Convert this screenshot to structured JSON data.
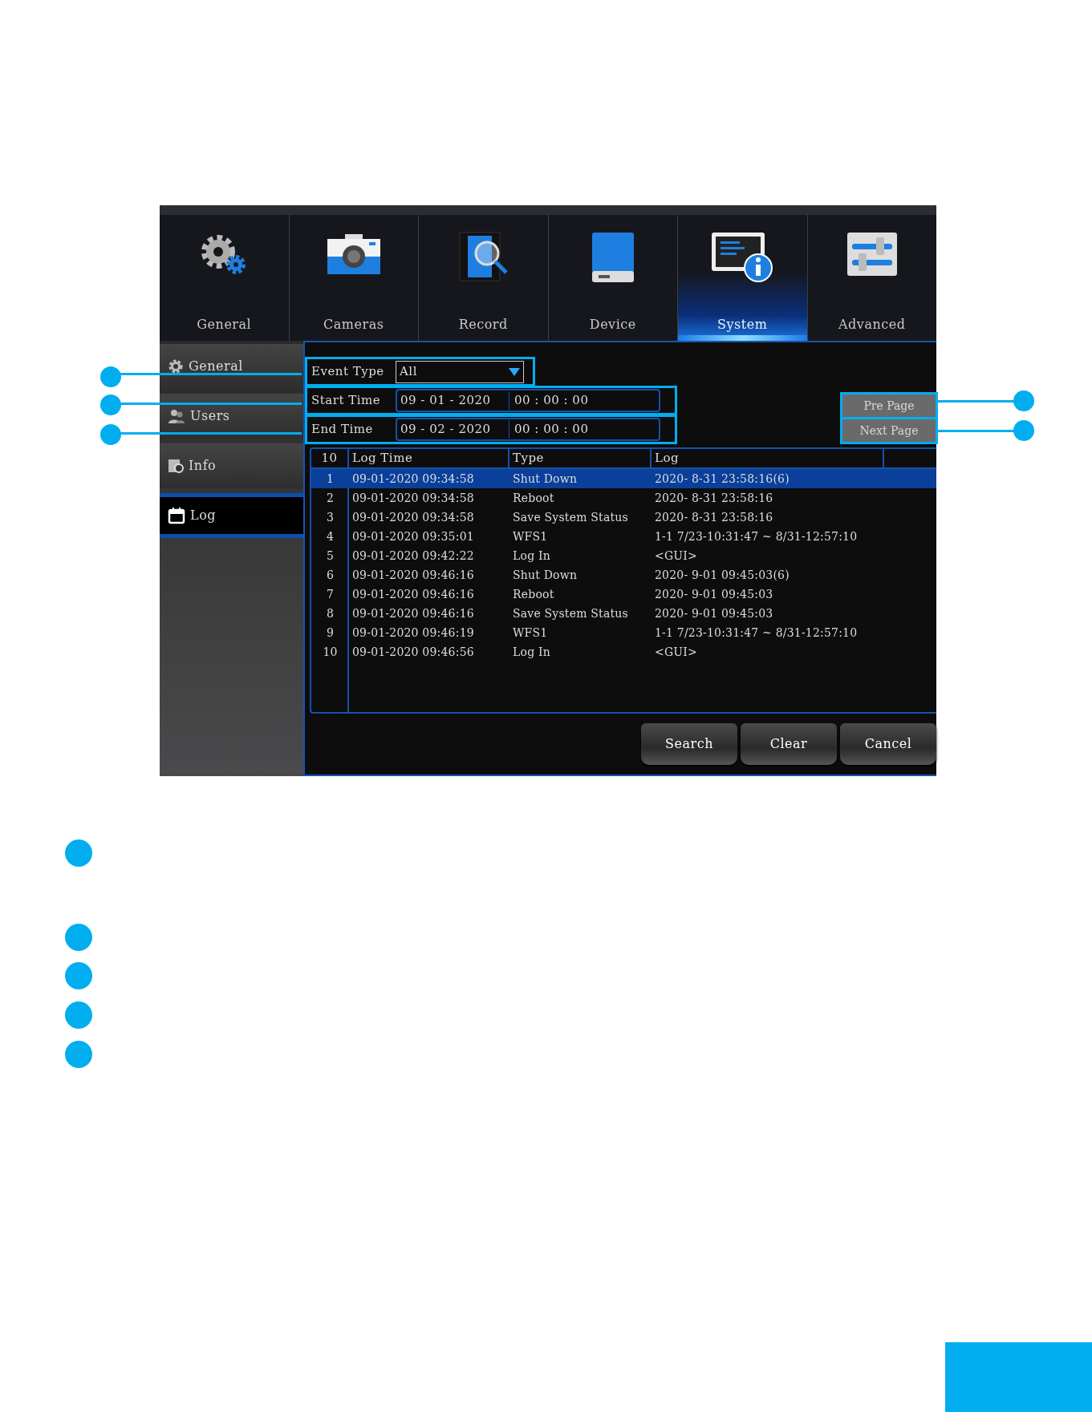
{
  "tabs": [
    {
      "label": "General",
      "selected": false
    },
    {
      "label": "Cameras",
      "selected": false
    },
    {
      "label": "Record",
      "selected": false
    },
    {
      "label": "Device",
      "selected": false
    },
    {
      "label": "System",
      "selected": true
    },
    {
      "label": "Advanced",
      "selected": false
    }
  ],
  "sidebar": {
    "items": [
      {
        "label": "General",
        "selected": false
      },
      {
        "label": "Users",
        "selected": false
      },
      {
        "label": "Info",
        "selected": false
      },
      {
        "label": "Log",
        "selected": true
      }
    ]
  },
  "filters": {
    "event_type": {
      "label": "Event Type",
      "value": "All"
    },
    "start_time": {
      "label": "Start Time",
      "date": "09 - 01 - 2020",
      "time": "00 : 00 : 00"
    },
    "end_time": {
      "label": "End Time",
      "date": "09 - 02 - 2020",
      "time": "00 : 00 : 00"
    }
  },
  "paging": [
    {
      "label": "Pre Page",
      "disabled": true
    },
    {
      "label": "Next Page",
      "disabled": true
    }
  ],
  "table": {
    "columns": [
      "10",
      "Log Time",
      "Type",
      "Log"
    ],
    "rows": [
      {
        "cells": [
          "1",
          "09-01-2020 09:34:58",
          "Shut Down",
          "2020- 8-31 23:58:16(6)"
        ],
        "selected": true
      },
      {
        "cells": [
          "2",
          "09-01-2020 09:34:58",
          "Reboot",
          "2020- 8-31 23:58:16"
        ],
        "selected": false
      },
      {
        "cells": [
          "3",
          "09-01-2020 09:34:58",
          "Save System Status",
          "2020- 8-31 23:58:16"
        ],
        "selected": false
      },
      {
        "cells": [
          "4",
          "09-01-2020 09:35:01",
          "WFS1",
          "1-1 7/23-10:31:47 ~ 8/31-12:57:10"
        ],
        "selected": false
      },
      {
        "cells": [
          "5",
          "09-01-2020 09:42:22",
          "Log In",
          "<GUI>"
        ],
        "selected": false
      },
      {
        "cells": [
          "6",
          "09-01-2020 09:46:16",
          "Shut Down",
          "2020- 9-01 09:45:03(6)"
        ],
        "selected": false
      },
      {
        "cells": [
          "7",
          "09-01-2020 09:46:16",
          "Reboot",
          "2020- 9-01 09:45:03"
        ],
        "selected": false
      },
      {
        "cells": [
          "8",
          "09-01-2020 09:46:16",
          "Save System Status",
          "2020- 9-01 09:45:03"
        ],
        "selected": false
      },
      {
        "cells": [
          "9",
          "09-01-2020 09:46:19",
          "WFS1",
          "1-1 7/23-10:31:47 ~ 8/31-12:57:10"
        ],
        "selected": false
      },
      {
        "cells": [
          "10",
          "09-01-2020 09:46:56",
          "Log In",
          "<GUI>"
        ],
        "selected": false
      }
    ]
  },
  "buttons": [
    "Search",
    "Clear",
    "Cancel"
  ]
}
